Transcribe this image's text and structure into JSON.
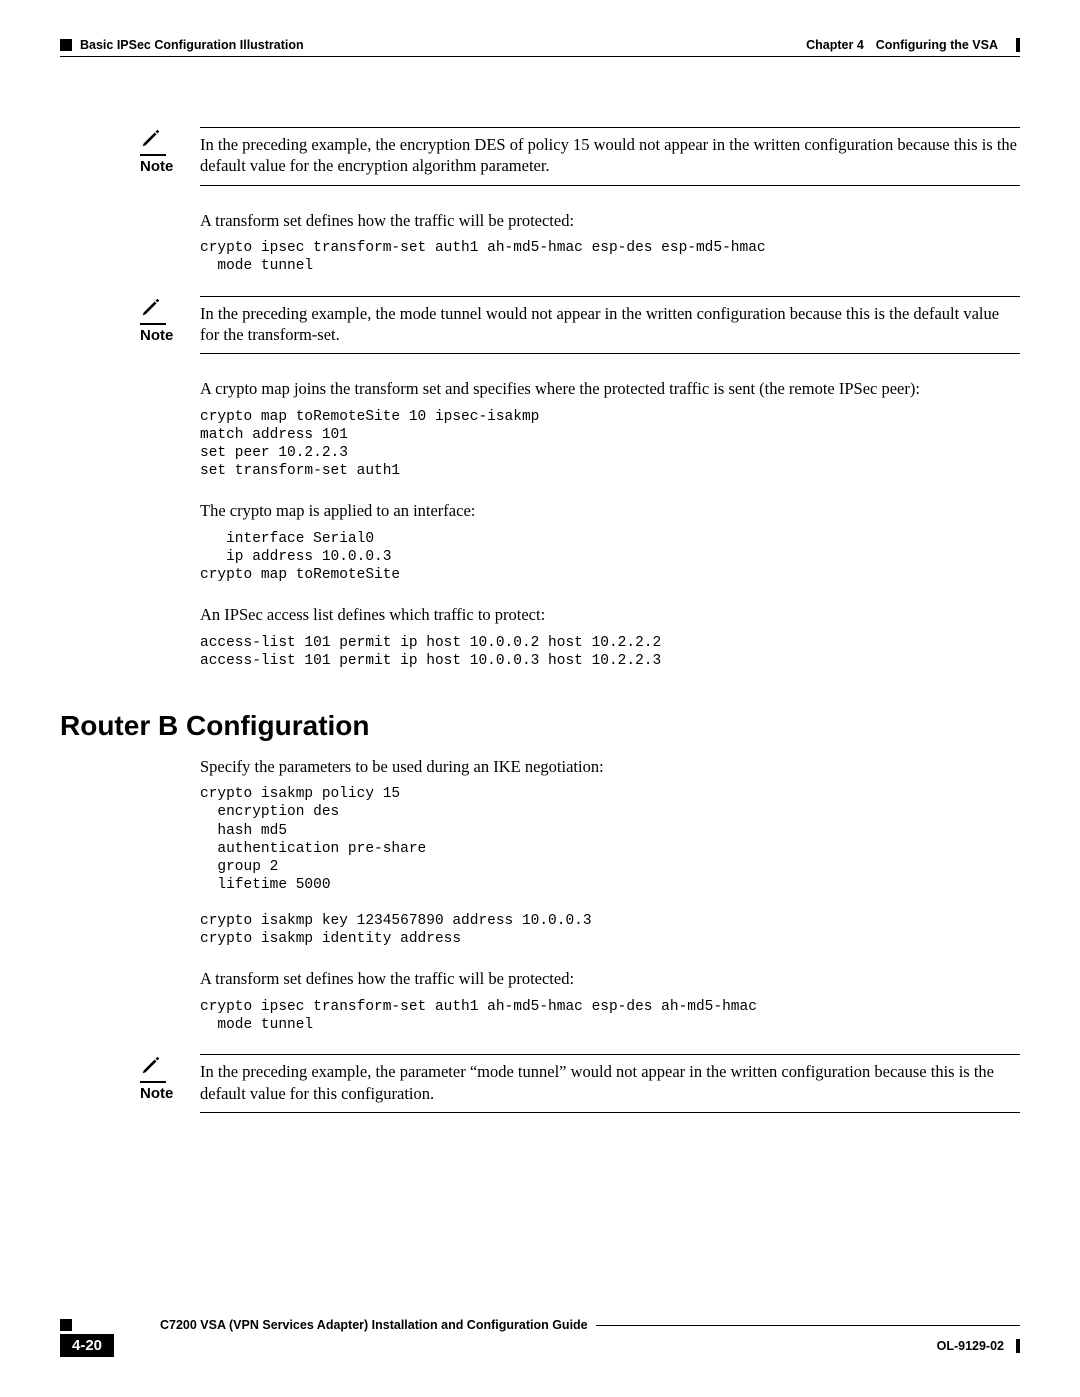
{
  "header": {
    "section_title": "Basic IPSec Configuration Illustration",
    "chapter_label": "Chapter 4",
    "chapter_title": "Configuring the VSA"
  },
  "notes": {
    "label": "Note",
    "n1": "In the preceding example, the encryption DES of policy 15 would not appear in the written configuration because this is the default value for the encryption algorithm parameter.",
    "n2": "In the preceding example, the mode tunnel would not appear in the written configuration because this is the default value for the transform-set.",
    "n3": "In the preceding example, the parameter “mode tunnel” would not appear in the written configuration because this is the default value for this configuration."
  },
  "paras": {
    "p1": "A transform set defines how the traffic will be protected:",
    "p2": "A crypto map joins the transform set and specifies where the protected traffic is sent (the remote IPSec peer):",
    "p3": "The crypto map is applied to an interface:",
    "p4": "An IPSec access list defines which traffic to protect:",
    "p5": "Specify the parameters to be used during an IKE negotiation:",
    "p6": "A transform set defines how the traffic will be protected:"
  },
  "code": {
    "c1": "crypto ipsec transform-set auth1 ah-md5-hmac esp-des esp-md5-hmac\n  mode tunnel",
    "c2": "crypto map toRemoteSite 10 ipsec-isakmp\nmatch address 101\nset peer 10.2.2.3\nset transform-set auth1",
    "c3": "   interface Serial0\n   ip address 10.0.0.3\ncrypto map toRemoteSite",
    "c4": "access-list 101 permit ip host 10.0.0.2 host 10.2.2.2\naccess-list 101 permit ip host 10.0.0.3 host 10.2.2.3",
    "c5": "crypto isakmp policy 15\n  encryption des\n  hash md5\n  authentication pre-share\n  group 2\n  lifetime 5000\n\ncrypto isakmp key 1234567890 address 10.0.0.3\ncrypto isakmp identity address",
    "c6": "crypto ipsec transform-set auth1 ah-md5-hmac esp-des ah-md5-hmac\n  mode tunnel"
  },
  "heading": {
    "router_b": "Router B Configuration"
  },
  "footer": {
    "guide_title": "C7200 VSA (VPN Services Adapter) Installation and Configuration Guide",
    "page_number": "4-20",
    "doc_id": "OL-9129-02"
  }
}
